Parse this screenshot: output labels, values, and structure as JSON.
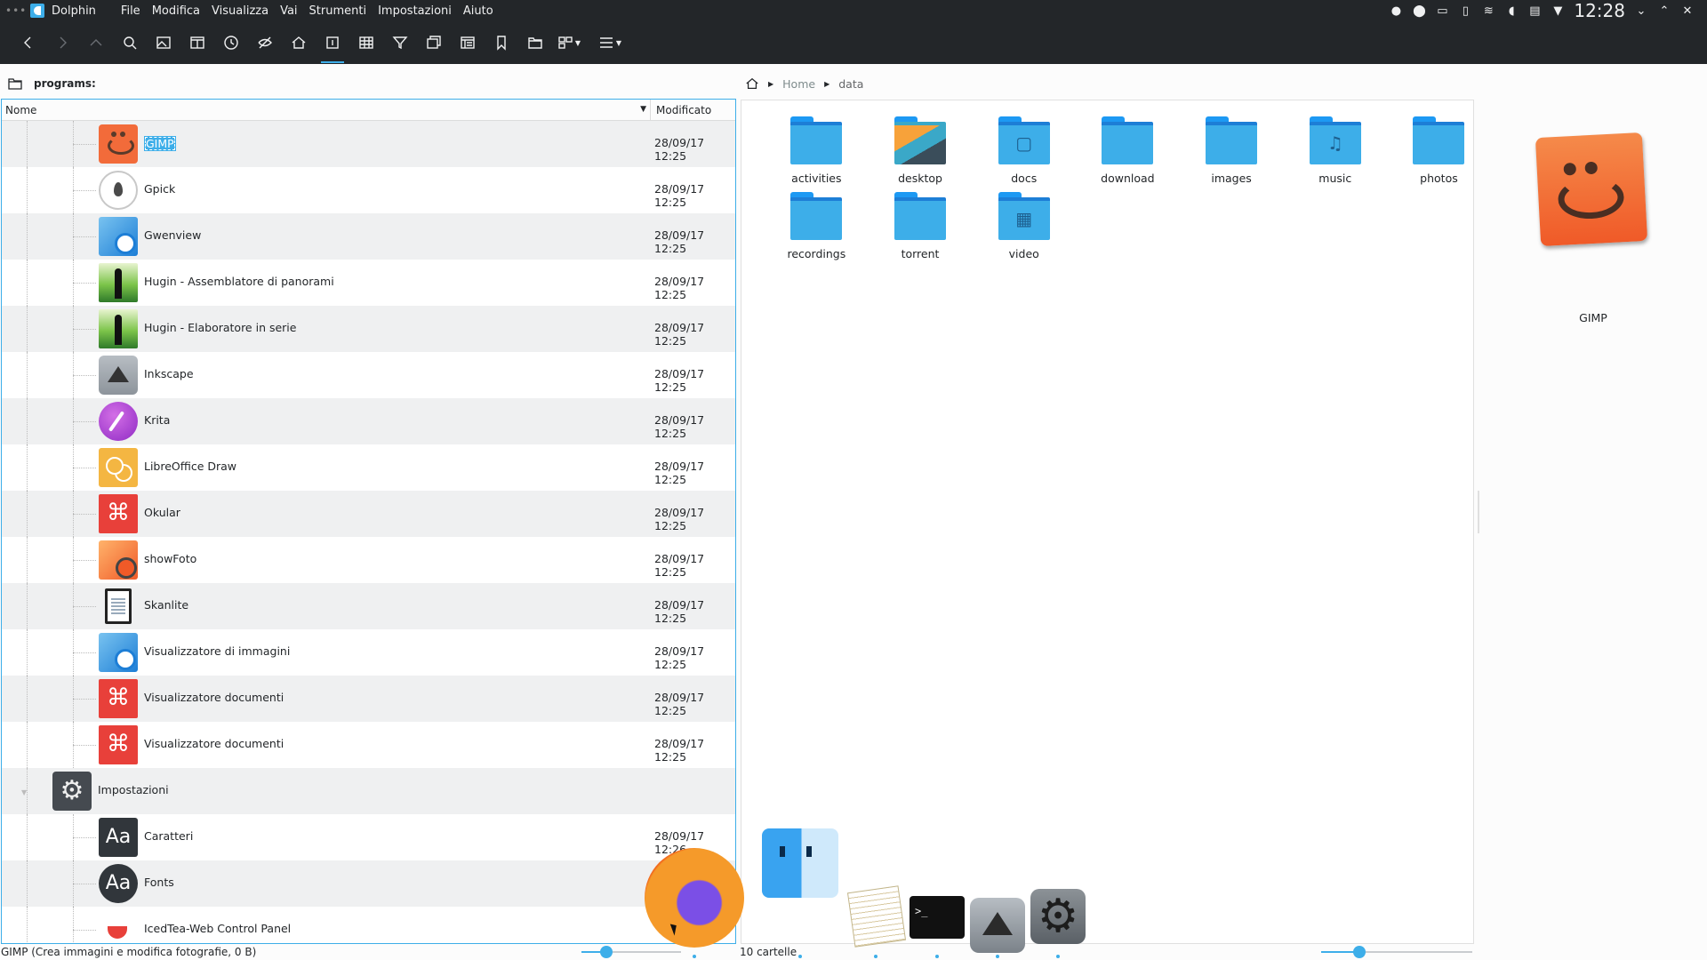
{
  "titlebar": {
    "app_name": "Dolphin",
    "menu": [
      "File",
      "Modifica",
      "Visualizza",
      "Vai",
      "Strumenti",
      "Impostazioni",
      "Aiuto"
    ],
    "clock": "12:28"
  },
  "toolbar": {
    "buttons": [
      "back",
      "forward",
      "up",
      "search",
      "preview",
      "split",
      "recent",
      "hidden-files",
      "home",
      "details-view",
      "compact-view",
      "filter",
      "new-window",
      "panels",
      "bookmark",
      "open-folder",
      "view-mode",
      "menu"
    ]
  },
  "left_pane": {
    "location": "programs:",
    "columns": {
      "name": "Nome",
      "modified": "Modificato"
    },
    "rows": [
      {
        "name": "GIMP",
        "modified": "28/09/17 12:25",
        "icon": "gimp-icon",
        "level": 2,
        "selected": true
      },
      {
        "name": "Gpick",
        "modified": "28/09/17 12:25",
        "icon": "gpick-icon",
        "level": 2
      },
      {
        "name": "Gwenview",
        "modified": "28/09/17 12:25",
        "icon": "gwenview-icon",
        "level": 2
      },
      {
        "name": "Hugin - Assemblatore di panorami",
        "modified": "28/09/17 12:25",
        "icon": "hugin-icon",
        "level": 2
      },
      {
        "name": "Hugin - Elaboratore in serie",
        "modified": "28/09/17 12:25",
        "icon": "hugin-icon",
        "level": 2
      },
      {
        "name": "Inkscape",
        "modified": "28/09/17 12:25",
        "icon": "inkscape-icon",
        "level": 2
      },
      {
        "name": "Krita",
        "modified": "28/09/17 12:25",
        "icon": "krita-icon",
        "level": 2
      },
      {
        "name": "LibreOffice Draw",
        "modified": "28/09/17 12:25",
        "icon": "libreoffice-draw-icon",
        "level": 2
      },
      {
        "name": "Okular",
        "modified": "28/09/17 12:25",
        "icon": "pdf-icon",
        "level": 2
      },
      {
        "name": "showFoto",
        "modified": "28/09/17 12:25",
        "icon": "showfoto-icon",
        "level": 2
      },
      {
        "name": "Skanlite",
        "modified": "28/09/17 12:25",
        "icon": "skanlite-icon",
        "level": 2
      },
      {
        "name": "Visualizzatore di immagini",
        "modified": "28/09/17 12:25",
        "icon": "gwenview-icon",
        "level": 2
      },
      {
        "name": "Visualizzatore documenti",
        "modified": "28/09/17 12:25",
        "icon": "pdf-icon",
        "level": 2
      },
      {
        "name": "Visualizzatore documenti",
        "modified": "28/09/17 12:25",
        "icon": "pdf-icon",
        "level": 2
      },
      {
        "name": "Impostazioni",
        "modified": "",
        "icon": "settings-icon",
        "level": 1
      },
      {
        "name": "Caratteri",
        "modified": "28/09/17 12:26",
        "icon": "fonts-icon",
        "level": 2
      },
      {
        "name": "Fonts",
        "modified": "",
        "icon": "fonts-round-icon",
        "level": 2
      },
      {
        "name": "IcedTea-Web Control Panel",
        "modified": "",
        "icon": "icedtea-icon",
        "level": 2
      }
    ]
  },
  "right_pane": {
    "breadcrumb": [
      "Home",
      "data"
    ],
    "folders": [
      {
        "name": "activities",
        "icon": "folder-icon",
        "glyph": ""
      },
      {
        "name": "desktop",
        "icon": "folder-desktop-icon",
        "glyph": ""
      },
      {
        "name": "docs",
        "icon": "folder-documents-icon",
        "glyph": "▢"
      },
      {
        "name": "download",
        "icon": "folder-icon",
        "glyph": ""
      },
      {
        "name": "images",
        "icon": "folder-icon",
        "glyph": ""
      },
      {
        "name": "music",
        "icon": "folder-music-icon",
        "glyph": "♫"
      },
      {
        "name": "photos",
        "icon": "folder-icon",
        "glyph": ""
      },
      {
        "name": "recordings",
        "icon": "folder-icon",
        "glyph": ""
      },
      {
        "name": "torrent",
        "icon": "folder-icon",
        "glyph": ""
      },
      {
        "name": "video",
        "icon": "folder-video-icon",
        "glyph": "▦"
      }
    ]
  },
  "preview": {
    "label": "GIMP"
  },
  "statusbar": {
    "left": "GIMP (Crea immagini e modifica fotografie, 0 B)",
    "right": "10 cartelle",
    "zoom_left": 0.25,
    "zoom_right": 0.25
  },
  "dock": {
    "items": [
      "firefox-icon",
      "finder-icon",
      "textedit-icon",
      "terminal-icon",
      "inkscape-icon",
      "system-settings-icon"
    ],
    "terminal_prompt": ">_"
  },
  "colors": {
    "accent": "#3daee9",
    "bar": "#232629",
    "selection": "#3daee9"
  }
}
